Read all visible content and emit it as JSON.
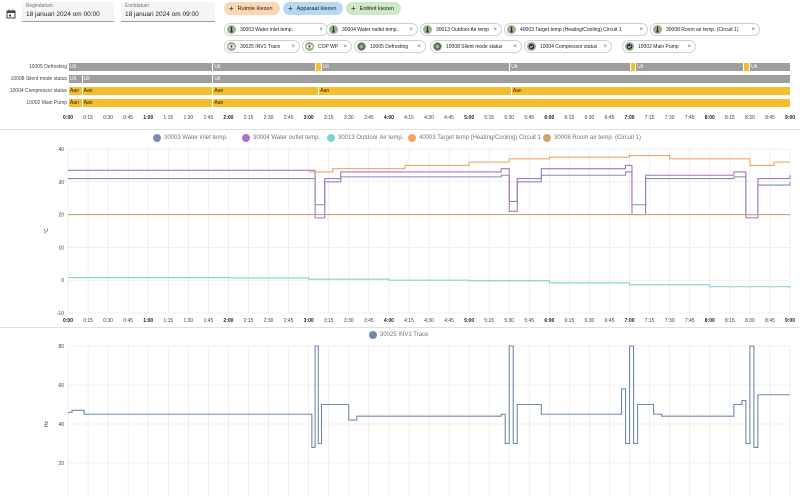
{
  "filters": {
    "start": {
      "label": "Begindatum",
      "value": "18 januari 2024 om 00:00"
    },
    "end": {
      "label": "Einddatum",
      "value": "18 januari 2024 om 09:00"
    }
  },
  "buttons": {
    "area": "Ruimte kiezen",
    "device": "Apparaat kiezen",
    "entity": "Entiteit kiezen"
  },
  "chips": [
    {
      "label": "30003 Water inlet temp."
    },
    {
      "label": "30004 Water outlet temp."
    },
    {
      "label": "30013 Outdoor Air temp."
    },
    {
      "label": "40003 Target temp (Heating/Cooling) Circuit 1"
    },
    {
      "label": "30008 Room air temp. (Circuit 1)"
    },
    {
      "label": "30025 INV1 Trace"
    },
    {
      "label": "COP WP"
    },
    {
      "label": "10005 Defrosting"
    },
    {
      "label": "10008 Silent mode status"
    },
    {
      "label": "10004 Compressor status"
    },
    {
      "label": "10002 Main Pump"
    }
  ],
  "timeline": {
    "lanes": [
      {
        "label": "10005 Defrosting",
        "segments": [
          {
            "text": "Uit",
            "state": "off",
            "from": 0,
            "to": 1.8
          },
          {
            "text": "Uit",
            "state": "off",
            "from": 1.8,
            "to": 3.08
          },
          {
            "text": "",
            "state": "on",
            "from": 3.08,
            "to": 3.15
          },
          {
            "text": "Uit",
            "state": "off",
            "from": 3.15,
            "to": 5.5
          },
          {
            "text": "Uit",
            "state": "off",
            "from": 5.5,
            "to": 7.0
          },
          {
            "text": "",
            "state": "on",
            "from": 7.0,
            "to": 7.07
          },
          {
            "text": "Uit",
            "state": "off",
            "from": 7.07,
            "to": 8.42
          },
          {
            "text": "",
            "state": "on",
            "from": 8.42,
            "to": 8.49
          },
          {
            "text": "Uit",
            "state": "off",
            "from": 8.49,
            "to": 9.0
          }
        ]
      },
      {
        "label": "10008 Silent mode status",
        "segments": [
          {
            "text": "Uit",
            "state": "off",
            "from": 0,
            "to": 0.17
          },
          {
            "text": "Uit",
            "state": "off",
            "from": 0.17,
            "to": 1.8
          },
          {
            "text": "Uit",
            "state": "off",
            "from": 1.8,
            "to": 9.0
          }
        ]
      },
      {
        "label": "10004 Compressor status",
        "segments": [
          {
            "text": "Aan",
            "state": "on",
            "from": 0,
            "to": 0.17
          },
          {
            "text": "Aan",
            "state": "on",
            "from": 0.17,
            "to": 1.8
          },
          {
            "text": "Aan",
            "state": "on",
            "from": 1.8,
            "to": 3.12
          },
          {
            "text": "Aan",
            "state": "on",
            "from": 3.12,
            "to": 5.52
          },
          {
            "text": "Aan",
            "state": "on",
            "from": 5.52,
            "to": 9.0
          }
        ]
      },
      {
        "label": "10002 Main Pump",
        "segments": [
          {
            "text": "Aan",
            "state": "on",
            "from": 0,
            "to": 0.17
          },
          {
            "text": "Aan",
            "state": "on",
            "from": 0.17,
            "to": 1.8
          },
          {
            "text": "Aan",
            "state": "on",
            "from": 1.8,
            "to": 9.0
          }
        ]
      }
    ]
  },
  "xticks": [
    "0:00",
    "0:15",
    "0:30",
    "0:45",
    "1:00",
    "1:15",
    "1:30",
    "1:45",
    "2:00",
    "2:15",
    "2:30",
    "2:45",
    "3:00",
    "3:15",
    "3:30",
    "3:45",
    "4:00",
    "4:15",
    "4:30",
    "4:45",
    "5:00",
    "5:15",
    "5:30",
    "5:45",
    "6:00",
    "6:15",
    "6:30",
    "6:45",
    "7:00",
    "7:15",
    "7:30",
    "7:45",
    "8:00",
    "8:15",
    "8:30",
    "8:45",
    "9:00"
  ],
  "colors": {
    "inlet": "#7b8fb6",
    "outlet": "#a874c4",
    "outdoor": "#7dd3d0",
    "target": "#f4a460",
    "room": "#c8a96a",
    "trace": "#6f89ad",
    "on": "#f6be2c",
    "off": "#9e9e9e"
  },
  "chart_data": [
    {
      "type": "line",
      "ylabel": "°C",
      "ylim": [
        -10,
        40
      ],
      "yticks": [
        -10,
        0,
        10,
        20,
        30,
        40
      ],
      "xlim": [
        "0:00",
        "9:00"
      ],
      "series": [
        {
          "name": "30003 Water inlet temp.",
          "x": [
            0,
            0.8,
            1.8,
            2.95,
            3.08,
            3.2,
            3.4,
            5.4,
            5.5,
            5.6,
            5.9,
            6.95,
            7.03,
            7.2,
            8.3,
            8.45,
            8.6,
            9.0
          ],
          "values": [
            31,
            31,
            31,
            31,
            23,
            30,
            31.5,
            32,
            24,
            30,
            32,
            33,
            23,
            31,
            31.5,
            20,
            29,
            30
          ]
        },
        {
          "name": "30004 Water outlet temp.",
          "x": [
            0,
            1.8,
            2.95,
            3.08,
            3.2,
            3.4,
            5.4,
            5.5,
            5.6,
            5.9,
            6.95,
            7.03,
            7.2,
            8.3,
            8.45,
            8.6,
            9.0
          ],
          "values": [
            33.5,
            33.5,
            33.5,
            19,
            31,
            33,
            34,
            21,
            31,
            34,
            35,
            20,
            32,
            33,
            19,
            31,
            32
          ]
        },
        {
          "name": "30013 Outdoor Air temp.",
          "x": [
            0,
            1,
            2,
            3,
            4,
            5,
            6,
            7,
            8,
            9
          ],
          "values": [
            0.8,
            0.8,
            0.7,
            0.3,
            0,
            -0.2,
            -0.8,
            -1.4,
            -2,
            -2.5
          ]
        },
        {
          "name": "40003 Target temp (Heating/Cooling) Circuit 1",
          "x": [
            3.0,
            3.3,
            4.2,
            5.0,
            5.5,
            6.0,
            7.0,
            7.5,
            8.5,
            8.8,
            9.0
          ],
          "values": [
            33,
            34,
            35,
            36,
            37,
            37.5,
            38,
            37,
            35,
            36,
            36
          ]
        },
        {
          "name": "30008 Room air temp. (Circuit 1)",
          "x": [
            0,
            9.0
          ],
          "values": [
            20,
            20
          ]
        }
      ]
    },
    {
      "type": "line",
      "ylabel": "Hz",
      "ylim": [
        0,
        80
      ],
      "yticks": [
        20,
        40,
        60,
        80
      ],
      "series": [
        {
          "name": "30025 INV1 Trace",
          "x": [
            0,
            0.05,
            0.2,
            3.0,
            3.04,
            3.08,
            3.12,
            3.16,
            3.3,
            3.5,
            3.6,
            5.4,
            5.45,
            5.5,
            5.55,
            5.6,
            5.8,
            5.9,
            6.9,
            6.95,
            7.0,
            7.05,
            7.1,
            7.3,
            7.4,
            8.3,
            8.4,
            8.45,
            8.5,
            8.55,
            8.6,
            8.8,
            9.0
          ],
          "values": [
            46,
            47,
            45,
            45,
            28,
            80,
            30,
            50,
            50,
            42,
            44,
            45,
            30,
            80,
            30,
            50,
            50,
            45,
            58,
            30,
            80,
            30,
            50,
            45,
            44,
            50,
            52,
            30,
            80,
            28,
            55,
            55,
            55
          ]
        }
      ]
    }
  ]
}
